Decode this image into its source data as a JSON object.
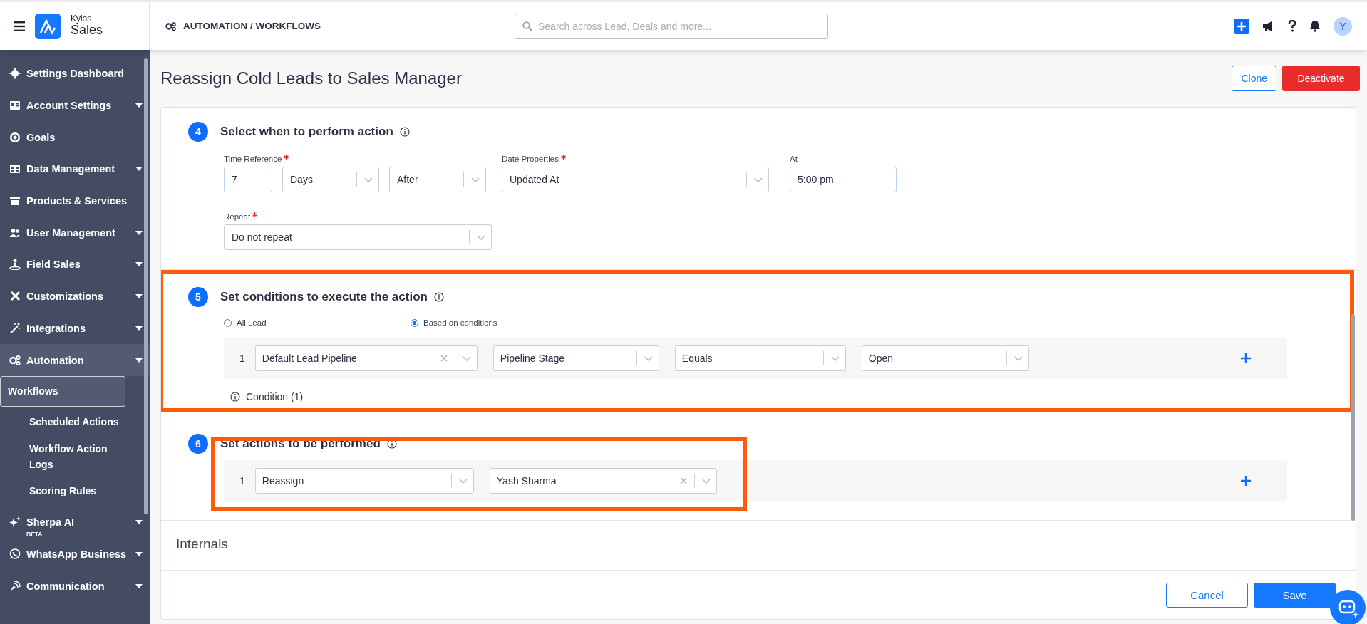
{
  "brand": {
    "top": "Kylas",
    "bottom": "Sales"
  },
  "breadcrumb": "AUTOMATION / WORKFLOWS",
  "search": {
    "placeholder": "Search across Lead, Deals and more..."
  },
  "avatar": "Y",
  "sidebar": {
    "items": [
      {
        "label": "Settings Dashboard",
        "expandable": false,
        "expanded": false
      },
      {
        "label": "Account Settings",
        "expandable": true,
        "expanded": false
      },
      {
        "label": "Goals",
        "expandable": false,
        "expanded": false
      },
      {
        "label": "Data Management",
        "expandable": true,
        "expanded": false
      },
      {
        "label": "Products & Services",
        "expandable": false,
        "expanded": false
      },
      {
        "label": "User Management",
        "expandable": true,
        "expanded": false
      },
      {
        "label": "Field Sales",
        "expandable": true,
        "expanded": false
      },
      {
        "label": "Customizations",
        "expandable": true,
        "expanded": false
      },
      {
        "label": "Integrations",
        "expandable": true,
        "expanded": false
      },
      {
        "label": "Automation",
        "expandable": true,
        "expanded": true,
        "children": [
          {
            "label": "Workflows",
            "selected": true
          },
          {
            "label": "Scheduled Actions",
            "selected": false
          },
          {
            "label": "Workflow Action Logs",
            "selected": false
          },
          {
            "label": "Scoring Rules",
            "selected": false
          }
        ]
      },
      {
        "label": "Sherpa AI",
        "expandable": true,
        "expanded": false,
        "badge": "BETA"
      },
      {
        "label": "WhatsApp Business",
        "expandable": true,
        "expanded": false
      },
      {
        "label": "Communication",
        "expandable": true,
        "expanded": false
      }
    ]
  },
  "page": {
    "title": "Reassign Cold Leads to Sales Manager",
    "buttons": [
      {
        "label": "Clone",
        "kind": "outline"
      },
      {
        "label": "Deactivate",
        "kind": "danger"
      }
    ]
  },
  "sections": [
    {
      "number": "4",
      "title": "Select when to perform action",
      "kind": "schedule",
      "highlighted": false,
      "rows": [
        [
          {
            "label": "Time Reference",
            "required": true,
            "controls": [
              {
                "kind": "input",
                "value": "7"
              },
              {
                "kind": "select",
                "value": "Days"
              },
              {
                "kind": "select",
                "value": "After"
              }
            ]
          },
          {
            "label": "Date Properties",
            "required": true,
            "controls": [
              {
                "kind": "select",
                "value": "Updated At"
              }
            ]
          },
          {
            "label": "At",
            "required": false,
            "controls": [
              {
                "kind": "input",
                "value": "5:00 pm"
              }
            ]
          }
        ],
        [
          {
            "label": "Repeat",
            "required": true,
            "controls": [
              {
                "kind": "select",
                "value": "Do not repeat"
              }
            ]
          }
        ]
      ]
    },
    {
      "number": "5",
      "title": "Set conditions to execute the action",
      "kind": "conditions",
      "highlighted": true,
      "options": [
        {
          "label": "All Lead",
          "selected": false
        },
        {
          "label": "Based on conditions",
          "selected": true
        }
      ],
      "rows": [
        {
          "number": "1",
          "fields": [
            {
              "value": "Default Lead Pipeline",
              "clearable": true
            },
            {
              "value": "Pipeline Stage",
              "clearable": false
            },
            {
              "value": "Equals",
              "clearable": false
            },
            {
              "value": "Open",
              "clearable": false
            }
          ]
        }
      ],
      "footer": "Condition (1)"
    },
    {
      "number": "6",
      "title": "Set actions to be performed",
      "kind": "actions",
      "highlighted": true,
      "rows": [
        {
          "number": "1",
          "fields": [
            {
              "value": "Reassign",
              "clearable": false
            },
            {
              "value": "Yash Sharma",
              "clearable": true
            }
          ]
        }
      ]
    }
  ],
  "internals": {
    "title": "Internals"
  },
  "footer_buttons": [
    {
      "label": "Cancel",
      "kind": "outline"
    },
    {
      "label": "Save",
      "kind": "primary"
    }
  ]
}
